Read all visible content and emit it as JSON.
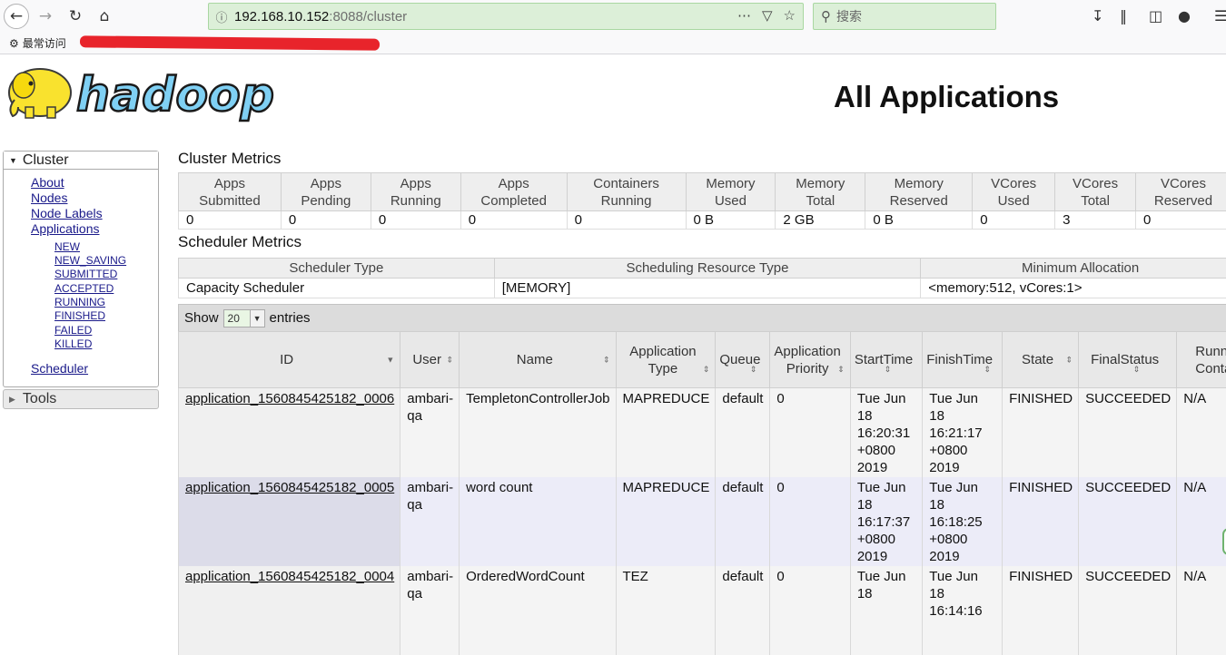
{
  "browser": {
    "url_host": "192.168.10.152",
    "url_rest": ":8088/cluster",
    "search_placeholder": "搜索",
    "bookmark_label": "最常访问"
  },
  "page": {
    "title": "All Applications"
  },
  "sidebar": {
    "cluster_label": "Cluster",
    "links": [
      "About",
      "Nodes",
      "Node Labels",
      "Applications"
    ],
    "app_states": [
      "NEW",
      "NEW_SAVING",
      "SUBMITTED",
      "ACCEPTED",
      "RUNNING",
      "FINISHED",
      "FAILED",
      "KILLED"
    ],
    "scheduler_label": "Scheduler",
    "tools_label": "Tools"
  },
  "cluster_metrics": {
    "title": "Cluster Metrics",
    "headers": [
      [
        "Apps",
        "Submitted"
      ],
      [
        "Apps",
        "Pending"
      ],
      [
        "Apps",
        "Running"
      ],
      [
        "Apps",
        "Completed"
      ],
      [
        "Containers",
        "Running"
      ],
      [
        "Memory",
        "Used"
      ],
      [
        "Memory",
        "Total"
      ],
      [
        "Memory",
        "Reserved"
      ],
      [
        "VCores",
        "Used"
      ],
      [
        "VCores",
        "Total"
      ],
      [
        "VCores",
        "Reserved"
      ]
    ],
    "values": [
      "0",
      "0",
      "0",
      "0",
      "0",
      "0 B",
      "2 GB",
      "0 B",
      "0",
      "3",
      "0"
    ]
  },
  "scheduler_metrics": {
    "title": "Scheduler Metrics",
    "headers": [
      "Scheduler Type",
      "Scheduling Resource Type",
      "Minimum Allocation"
    ],
    "values": [
      "Capacity Scheduler",
      "[MEMORY]",
      "<memory:512, vCores:1>"
    ]
  },
  "apps": {
    "show_label": "Show",
    "entries_value": "20",
    "entries_label": "entries",
    "headers": [
      [
        "ID"
      ],
      [
        "User"
      ],
      [
        "Name"
      ],
      [
        "Application",
        "Type"
      ],
      [
        "Queue"
      ],
      [
        "Application",
        "Priority"
      ],
      [
        "StartTime"
      ],
      [
        "FinishTime"
      ],
      [
        "State"
      ],
      [
        "FinalStatus"
      ],
      [
        "Running",
        "Containers"
      ]
    ],
    "rows": [
      {
        "id": "application_1560845425182_0006",
        "user": [
          "ambari-",
          "qa"
        ],
        "name": "TempletonControllerJob",
        "type": "MAPREDUCE",
        "queue": "default",
        "priority": "0",
        "start": [
          "Tue Jun",
          "18",
          "16:20:31",
          "+0800",
          "2019"
        ],
        "finish": [
          "Tue Jun 18",
          "16:21:17",
          "+0800",
          "2019"
        ],
        "state": "FINISHED",
        "final": "SUCCEEDED",
        "running": "N/A"
      },
      {
        "id": "application_1560845425182_0005",
        "user": [
          "ambari-",
          "qa"
        ],
        "name": "word count",
        "type": "MAPREDUCE",
        "queue": "default",
        "priority": "0",
        "start": [
          "Tue Jun",
          "18",
          "16:17:37",
          "+0800",
          "2019"
        ],
        "finish": [
          "Tue Jun 18",
          "16:18:25",
          "+0800",
          "2019"
        ],
        "state": "FINISHED",
        "final": "SUCCEEDED",
        "running": "N/A"
      },
      {
        "id": "application_1560845425182_0004",
        "user": [
          "ambari-",
          "qa"
        ],
        "name": "OrderedWordCount",
        "type": "TEZ",
        "queue": "default",
        "priority": "0",
        "start": [
          "Tue Jun",
          "18"
        ],
        "finish": [
          "Tue Jun 18",
          "16:14:16"
        ],
        "state": "FINISHED",
        "final": "SUCCEEDED",
        "running": "N/A"
      }
    ]
  }
}
